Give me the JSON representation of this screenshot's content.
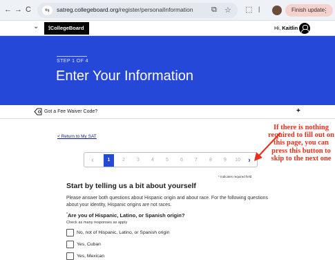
{
  "browser": {
    "back_glyph": "←",
    "forward_glyph": "→",
    "reload_glyph": "C",
    "tune_glyph": "⇆",
    "url_host": "satreg.collegeboard.org",
    "url_path": "/register/personalInformation",
    "finish_update_label": "Finish update",
    "menu_glyph": "⋮"
  },
  "site_header": {
    "menu_glyph": "⌄",
    "logo_text": "⟟CollegeBoard",
    "greeting_prefix": "Hi,",
    "user_name": "Kaitlin"
  },
  "hero": {
    "step_label": "STEP 1 OF 4",
    "title": "Enter Your Information"
  },
  "fee_waiver": {
    "label": "Got a Fee Waiver Code?",
    "expand_glyph": "+"
  },
  "content": {
    "return_link": "< Return to My SAT",
    "pager": {
      "prev_glyph": "‹",
      "next_glyph": "›",
      "pages": [
        "1",
        "2",
        "3",
        "4",
        "5",
        "6",
        "7",
        "8",
        "9",
        "10"
      ],
      "current_page": "1"
    },
    "required_note": "* Indicates required field",
    "section_title": "Start by telling us a bit about yourself",
    "instructions": "Please answer both questions about Hispanic origin and about race. For the following questions about your identity, Hispanic origins are not races.",
    "question": {
      "required_mark": "*",
      "text": "Are you of Hispanic, Latino, or Spanish origin?",
      "hint": "Check as many responses as apply",
      "options": [
        "No, not of Hispanic, Latino, or Spanish origin",
        "Yes, Cuban",
        "Yes, Mexican"
      ]
    }
  },
  "annotation": {
    "text": "If there is nothing required to fill out on this page, you can press this button to skip to the next one",
    "color": "#e8301c"
  },
  "colors": {
    "brand_blue": "#2548d8",
    "header_black": "#000000"
  }
}
